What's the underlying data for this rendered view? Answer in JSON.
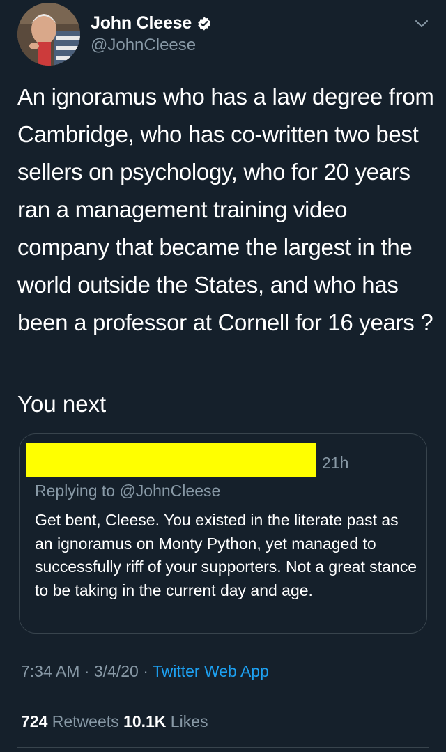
{
  "author": {
    "display_name": "John Cleese",
    "handle": "@JohnCleese",
    "avatar_icon": "profile-photo",
    "verified_icon": "verified-badge-icon"
  },
  "tweet": {
    "text": "An ignoramus who has a law degree from Cambridge, who has co-written two best sellers on psychology, who for 20 years ran a management training video company that became the largest in the world outside the States, and who has been a professor at Cornell for 16 years ?",
    "text_2": "You next"
  },
  "quoted_tweet": {
    "time": "21h",
    "replying_to": "Replying to @JohnCleese",
    "text": "Get bent, Cleese.  You existed in the literate past as an ignoramus on Monty Python, yet managed to successfully riff of your supporters.  Not a great stance to be taking in the current day and age."
  },
  "meta": {
    "time": "7:34 AM",
    "sep": "·",
    "date": "3/4/20",
    "app": "Twitter Web App"
  },
  "stats": {
    "retweets_count": "724",
    "retweets_label": "Retweets",
    "likes_count": "10.1K",
    "likes_label": "Likes"
  },
  "colors": {
    "background": "#15202b",
    "secondary_text": "#8899a6",
    "link": "#1da1f2",
    "border": "#38444d",
    "redaction": "#ffff00"
  }
}
